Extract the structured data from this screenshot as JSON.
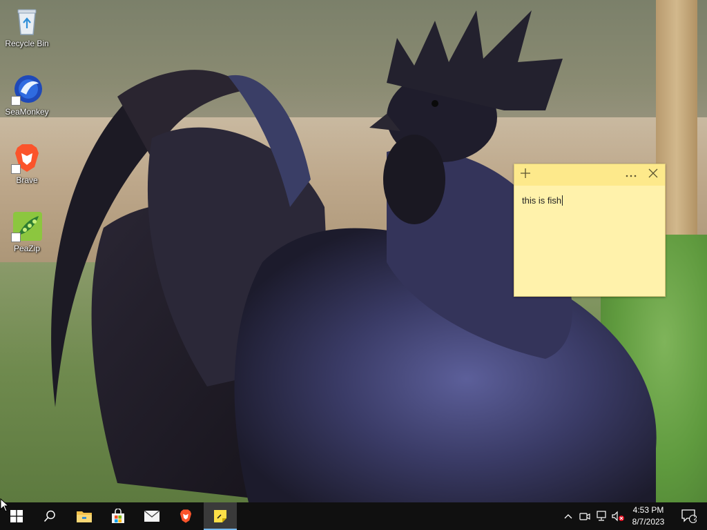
{
  "desktop": {
    "icons": [
      {
        "label": "Recycle Bin",
        "icon": "recycle-bin-icon"
      },
      {
        "label": "SeaMonkey",
        "icon": "seamonkey-icon"
      },
      {
        "label": "Brave",
        "icon": "brave-icon"
      },
      {
        "label": "PeaZip",
        "icon": "peazip-icon"
      }
    ]
  },
  "sticky_note": {
    "text": "this is fish",
    "add_icon": "plus-icon",
    "menu_icon": "more-icon",
    "close_icon": "close-icon",
    "colors": {
      "body": "#fff2ab",
      "header": "#fde98b"
    }
  },
  "taskbar": {
    "start_icon": "windows-start-icon",
    "search_icon": "search-icon",
    "pinned": [
      {
        "name": "file-explorer",
        "icon": "folder-icon"
      },
      {
        "name": "microsoft-store",
        "icon": "store-icon"
      },
      {
        "name": "mail",
        "icon": "mail-icon"
      },
      {
        "name": "brave",
        "icon": "brave-icon"
      },
      {
        "name": "sticky-notes",
        "icon": "sticky-notes-icon",
        "active": true
      }
    ],
    "tray": {
      "icons": [
        "chevron-up-icon",
        "meet-now-icon",
        "network-icon",
        "volume-muted-icon"
      ],
      "time": "4:53 PM",
      "date": "8/7/2023",
      "notification_count": "2"
    },
    "colors": {
      "background": "#101010",
      "active_underline": "#76b9ed"
    }
  }
}
